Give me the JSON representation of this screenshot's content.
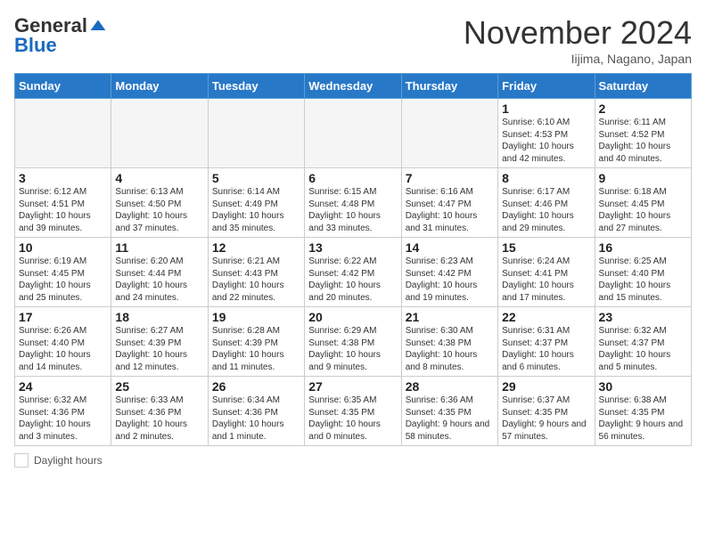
{
  "header": {
    "logo_general": "General",
    "logo_blue": "Blue",
    "month_title": "November 2024",
    "location": "Iijima, Nagano, Japan"
  },
  "weekdays": [
    "Sunday",
    "Monday",
    "Tuesday",
    "Wednesday",
    "Thursday",
    "Friday",
    "Saturday"
  ],
  "footer": {
    "label": "Daylight hours"
  },
  "weeks": [
    [
      {
        "day": "",
        "info": ""
      },
      {
        "day": "",
        "info": ""
      },
      {
        "day": "",
        "info": ""
      },
      {
        "day": "",
        "info": ""
      },
      {
        "day": "",
        "info": ""
      },
      {
        "day": "1",
        "info": "Sunrise: 6:10 AM\nSunset: 4:53 PM\nDaylight: 10 hours and 42 minutes."
      },
      {
        "day": "2",
        "info": "Sunrise: 6:11 AM\nSunset: 4:52 PM\nDaylight: 10 hours and 40 minutes."
      }
    ],
    [
      {
        "day": "3",
        "info": "Sunrise: 6:12 AM\nSunset: 4:51 PM\nDaylight: 10 hours and 39 minutes."
      },
      {
        "day": "4",
        "info": "Sunrise: 6:13 AM\nSunset: 4:50 PM\nDaylight: 10 hours and 37 minutes."
      },
      {
        "day": "5",
        "info": "Sunrise: 6:14 AM\nSunset: 4:49 PM\nDaylight: 10 hours and 35 minutes."
      },
      {
        "day": "6",
        "info": "Sunrise: 6:15 AM\nSunset: 4:48 PM\nDaylight: 10 hours and 33 minutes."
      },
      {
        "day": "7",
        "info": "Sunrise: 6:16 AM\nSunset: 4:47 PM\nDaylight: 10 hours and 31 minutes."
      },
      {
        "day": "8",
        "info": "Sunrise: 6:17 AM\nSunset: 4:46 PM\nDaylight: 10 hours and 29 minutes."
      },
      {
        "day": "9",
        "info": "Sunrise: 6:18 AM\nSunset: 4:45 PM\nDaylight: 10 hours and 27 minutes."
      }
    ],
    [
      {
        "day": "10",
        "info": "Sunrise: 6:19 AM\nSunset: 4:45 PM\nDaylight: 10 hours and 25 minutes."
      },
      {
        "day": "11",
        "info": "Sunrise: 6:20 AM\nSunset: 4:44 PM\nDaylight: 10 hours and 24 minutes."
      },
      {
        "day": "12",
        "info": "Sunrise: 6:21 AM\nSunset: 4:43 PM\nDaylight: 10 hours and 22 minutes."
      },
      {
        "day": "13",
        "info": "Sunrise: 6:22 AM\nSunset: 4:42 PM\nDaylight: 10 hours and 20 minutes."
      },
      {
        "day": "14",
        "info": "Sunrise: 6:23 AM\nSunset: 4:42 PM\nDaylight: 10 hours and 19 minutes."
      },
      {
        "day": "15",
        "info": "Sunrise: 6:24 AM\nSunset: 4:41 PM\nDaylight: 10 hours and 17 minutes."
      },
      {
        "day": "16",
        "info": "Sunrise: 6:25 AM\nSunset: 4:40 PM\nDaylight: 10 hours and 15 minutes."
      }
    ],
    [
      {
        "day": "17",
        "info": "Sunrise: 6:26 AM\nSunset: 4:40 PM\nDaylight: 10 hours and 14 minutes."
      },
      {
        "day": "18",
        "info": "Sunrise: 6:27 AM\nSunset: 4:39 PM\nDaylight: 10 hours and 12 minutes."
      },
      {
        "day": "19",
        "info": "Sunrise: 6:28 AM\nSunset: 4:39 PM\nDaylight: 10 hours and 11 minutes."
      },
      {
        "day": "20",
        "info": "Sunrise: 6:29 AM\nSunset: 4:38 PM\nDaylight: 10 hours and 9 minutes."
      },
      {
        "day": "21",
        "info": "Sunrise: 6:30 AM\nSunset: 4:38 PM\nDaylight: 10 hours and 8 minutes."
      },
      {
        "day": "22",
        "info": "Sunrise: 6:31 AM\nSunset: 4:37 PM\nDaylight: 10 hours and 6 minutes."
      },
      {
        "day": "23",
        "info": "Sunrise: 6:32 AM\nSunset: 4:37 PM\nDaylight: 10 hours and 5 minutes."
      }
    ],
    [
      {
        "day": "24",
        "info": "Sunrise: 6:32 AM\nSunset: 4:36 PM\nDaylight: 10 hours and 3 minutes."
      },
      {
        "day": "25",
        "info": "Sunrise: 6:33 AM\nSunset: 4:36 PM\nDaylight: 10 hours and 2 minutes."
      },
      {
        "day": "26",
        "info": "Sunrise: 6:34 AM\nSunset: 4:36 PM\nDaylight: 10 hours and 1 minute."
      },
      {
        "day": "27",
        "info": "Sunrise: 6:35 AM\nSunset: 4:35 PM\nDaylight: 10 hours and 0 minutes."
      },
      {
        "day": "28",
        "info": "Sunrise: 6:36 AM\nSunset: 4:35 PM\nDaylight: 9 hours and 58 minutes."
      },
      {
        "day": "29",
        "info": "Sunrise: 6:37 AM\nSunset: 4:35 PM\nDaylight: 9 hours and 57 minutes."
      },
      {
        "day": "30",
        "info": "Sunrise: 6:38 AM\nSunset: 4:35 PM\nDaylight: 9 hours and 56 minutes."
      }
    ]
  ]
}
